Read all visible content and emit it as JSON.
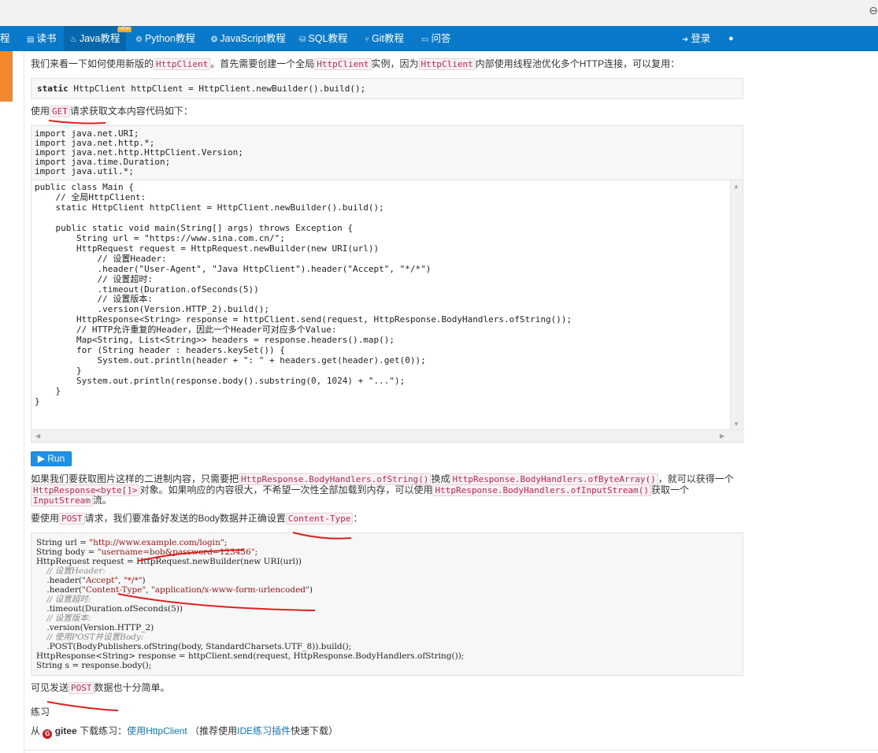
{
  "window": {
    "corner_icon": "⊖"
  },
  "nav": {
    "items": [
      {
        "label": "程",
        "icon": ""
      },
      {
        "label": "读书",
        "icon": "▤"
      },
      {
        "label": "Java教程",
        "icon": "♨",
        "badge": "NEW"
      },
      {
        "label": "Python教程",
        "icon": "⚙"
      },
      {
        "label": "JavaScript教程",
        "icon": "❂"
      },
      {
        "label": "SQL教程",
        "icon": "⛁"
      },
      {
        "label": "Git教程",
        "icon": "⑂"
      },
      {
        "label": "问答",
        "icon": "▭"
      }
    ],
    "login": "登录",
    "login_icon": "➜",
    "globe_icon": "●"
  },
  "intro": {
    "p1_a": "我们来看一下如何使用新版的",
    "p1_code1": "HttpClient",
    "p1_b": "。首先需要创建一个全局",
    "p1_code2": "HttpClient",
    "p1_c": "实例，因为",
    "p1_code3": "HttpClient",
    "p1_d": "内部使用线程池优化多个HTTP连接，可以复用："
  },
  "code1": {
    "kw": "static",
    "rest": " HttpClient httpClient = HttpClient.newBuilder().build();"
  },
  "get_para": {
    "a": "使用",
    "code": "GET",
    "b": "请求获取文本内容代码如下："
  },
  "imports": "import java.net.URI;\nimport java.net.http.*;\nimport java.net.http.HttpClient.Version;\nimport java.time.Duration;\nimport java.util.*;",
  "editor_code": "public class Main {\n    // 全局HttpClient:\n    static HttpClient httpClient = HttpClient.newBuilder().build();\n\n    public static void main(String[] args) throws Exception {\n        String url = \"https://www.sina.com.cn/\";\n        HttpRequest request = HttpRequest.newBuilder(new URI(url))\n            // 设置Header:\n            .header(\"User-Agent\", \"Java HttpClient\").header(\"Accept\", \"*/*\")\n            // 设置超时:\n            .timeout(Duration.ofSeconds(5))\n            // 设置版本:\n            .version(Version.HTTP_2).build();\n        HttpResponse<String> response = httpClient.send(request, HttpResponse.BodyHandlers.ofString());\n        // HTTP允许重复的Header，因此一个Header可对应多个Value:\n        Map<String, List<String>> headers = response.headers().map();\n        for (String header : headers.keySet()) {\n            System.out.println(header + \": \" + headers.get(header).get(0));\n        }\n        System.out.println(response.body().substring(0, 1024) + \"...\");\n    }\n}",
  "run_label": "▶ Run",
  "binary_para": {
    "a": "如果我们要获取图片这样的二进制内容，只需要把",
    "code1": "HttpResponse.BodyHandlers.ofString()",
    "b": "换成",
    "code2": "HttpResponse.BodyHandlers.ofByteArray()",
    "c": "，就可以获得一个",
    "code3": "HttpResponse<byte[]>",
    "d": "对象。如果响应的内容很大，不希望一次性全部加载到内存，可以使用",
    "code4": "HttpResponse.BodyHandlers.ofInputStream()",
    "e": "获取一个",
    "code5": "InputStream",
    "f": "流。"
  },
  "post_para": {
    "a": "要使用",
    "code1": "POST",
    "b": "请求，我们要准备好发送的Body数据并正确设置",
    "code2": "Content-Type",
    "c": "："
  },
  "post_code": {
    "l1a": "String url = ",
    "l1s": "\"http://www.example.com/login\"",
    "l1b": ";",
    "l2a": "String body = ",
    "l2s": "\"username=bob&password=123456\"",
    "l2b": ";",
    "l3": "HttpRequest request = HttpRequest.newBuilder(new URI(url))",
    "c1": "    // 设置Header:",
    "l4a": "    .header(",
    "l4s1": "\"Accept\"",
    "l4m": ", ",
    "l4s2": "\"*/*\"",
    "l4b": ")",
    "l5a": "    .header(",
    "l5s1": "\"Content-Type\"",
    "l5m": ", ",
    "l5s2": "\"application/x-www-form-urlencoded\"",
    "l5b": ")",
    "c2": "    // 设置超时:",
    "l6": "    .timeout(Duration.ofSeconds(5))",
    "c3": "    // 设置版本:",
    "l7": "    .version(Version.HTTP_2)",
    "c4": "    // 使用POST并设置Body:",
    "l8": "    .POST(BodyPublishers.ofString(body, StandardCharsets.UTF_8)).build();",
    "l9": "HttpResponse<String> response = httpClient.send(request, HttpResponse.BodyHandlers.ofString());",
    "l10": "String s = response.body();"
  },
  "simple_para": {
    "a": "可见发送",
    "code": "POST",
    "b": "数据也十分简单。"
  },
  "exercise": {
    "heading": "练习",
    "from": "从",
    "gitee": "gitee",
    "gitee_icon": "G",
    "download": "下载练习：",
    "link1": "使用HttpClient",
    "paren_a": "（推荐使用",
    "link2": "IDE练习插件",
    "paren_b": "快速下载）"
  }
}
